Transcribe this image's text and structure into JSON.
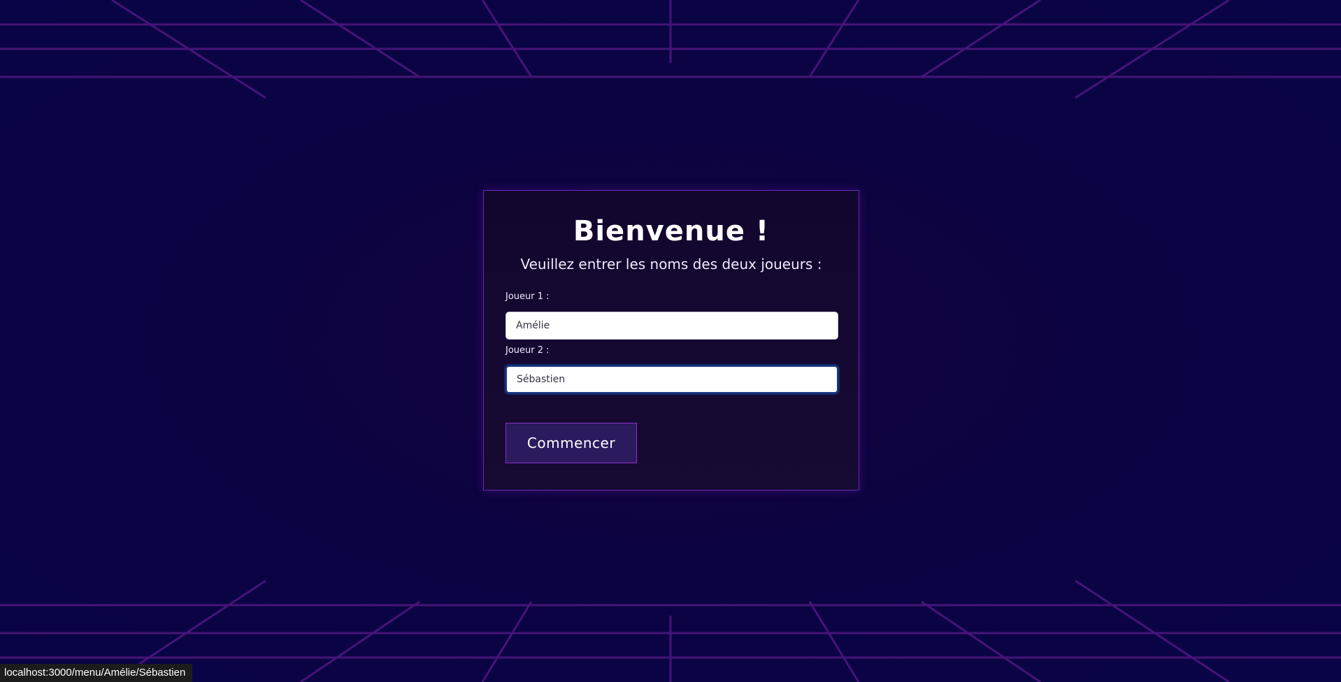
{
  "colors": {
    "background": "#0b0340",
    "grid_line": "#5a1a8c",
    "card_border": "#6e24b8",
    "button_bg": "#2b1a5e",
    "button_border": "#8b2fc9"
  },
  "card": {
    "title": "Bienvenue !",
    "subtitle": "Veuillez entrer les noms des deux joueurs :"
  },
  "form": {
    "player1": {
      "label": "Joueur 1 :",
      "value": "Amélie"
    },
    "player2": {
      "label": "Joueur 2 :",
      "value": "Sébastien"
    },
    "submit_label": "Commencer"
  },
  "status_bar": {
    "url": "localhost:3000/menu/Amélie/Sébastien"
  }
}
